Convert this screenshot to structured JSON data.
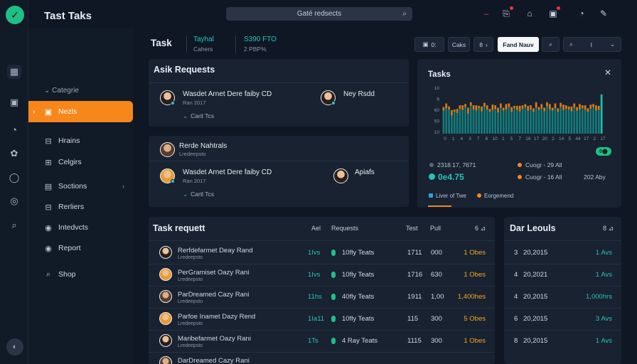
{
  "app": {
    "title": "Tast Taks",
    "logo_glyph": "✓"
  },
  "rail_icons": [
    "building-icon",
    "box-icon",
    "gauge-icon",
    "gear-icon",
    "circle-icon",
    "target-icon",
    "search-doc-icon"
  ],
  "rail_bottom": "◐",
  "sidebar": {
    "section_label": "Categrie",
    "items": [
      {
        "label": "Nezls",
        "icon": "▣",
        "active": true
      },
      {
        "label": "Hrains",
        "icon": "⊟"
      },
      {
        "label": "Celgirs",
        "icon": "⊞"
      },
      {
        "label": "Soctions",
        "icon": "▤",
        "chevron": "›"
      },
      {
        "label": "Rerliers",
        "icon": "⊟"
      },
      {
        "label": "Intedvcts",
        "icon": "◉"
      },
      {
        "label": "Report",
        "icon": "◉"
      },
      {
        "label": "Shop",
        "icon": "⌕"
      }
    ]
  },
  "topbar": {
    "search_placeholder": "Gaté redsects",
    "search_icon": "⌕",
    "icons": [
      {
        "name": "minus-icon",
        "glyph": "–",
        "color": "#e5393c"
      },
      {
        "name": "clipboard-icon",
        "glyph": "⎘",
        "dot": true
      },
      {
        "name": "home-icon",
        "glyph": "⌂"
      },
      {
        "name": "calendar-icon",
        "glyph": "▣",
        "dot": true
      },
      {
        "name": "palette-icon",
        "glyph": "◔"
      },
      {
        "name": "tools-icon",
        "glyph": "✎"
      }
    ]
  },
  "header": {
    "title": "Task",
    "meta": [
      {
        "value": "Tayhal",
        "label": "Cahers"
      },
      {
        "value": "Ѕ390 FTO",
        "label": "2 PBP%"
      }
    ],
    "buttons": [
      {
        "label": "0:",
        "icon": "▣"
      },
      {
        "label": "Caks"
      },
      {
        "label": "›",
        "icon": "8"
      },
      {
        "label": "Fand Nauv",
        "primary": true
      },
      {
        "label": "⌕"
      },
      {
        "label": "I",
        "icon": "⌕",
        "chevron": "⌄"
      }
    ]
  },
  "requests": {
    "title": "Asik Requests",
    "rows": [
      {
        "left": {
          "name": "Wasdet Arnet Dere faiby CD",
          "sub": "Ran 2017",
          "tag": "Carit Tcs"
        },
        "right": {
          "name": "Ney Rsdd"
        }
      },
      {
        "single": {
          "name": "Rerde Nahtrals",
          "sub": "Lredeepsto"
        }
      },
      {
        "left": {
          "name": "Wasdet Arnet Dere faiby CD",
          "sub": "Ran 2017",
          "tag": "Cartl Tcs"
        },
        "right": {
          "name": "Apiafs"
        }
      }
    ]
  },
  "tasks_panel": {
    "title": "Tasks",
    "close": "✕",
    "badge": "0⬤",
    "y_ticks": [
      "10",
      "8",
      "60",
      "50",
      "10"
    ],
    "x_ticks": [
      "0",
      "1",
      "4",
      "3",
      "7",
      "6",
      "10",
      "1",
      "5",
      "7",
      "16",
      "17",
      "20",
      "2",
      "14",
      "5",
      "44",
      "17",
      "2",
      "17"
    ],
    "stats": [
      {
        "text": "2318.17, 7671",
        "dot": "#5a6676"
      },
      {
        "text": "Cuogr - 29 All",
        "dot": "#f7861b"
      },
      {
        "text": "0e4.75",
        "dot": "#27c3ba",
        "big": true
      },
      {
        "text": "Cuogr - 16 All",
        "dot": "#f7861b"
      },
      {
        "text": "202 Aby"
      }
    ],
    "legend": [
      {
        "label": "Liver of Twe",
        "color": "#29a3e0"
      },
      {
        "label": "Eorgemend",
        "color": "#f7861b"
      }
    ]
  },
  "chart_data": {
    "type": "bar",
    "stacked": true,
    "x": [
      "0",
      "1",
      "4",
      "3",
      "7",
      "6",
      "10",
      "1",
      "5",
      "7",
      "16",
      "17",
      "20",
      "2",
      "14",
      "5",
      "44",
      "17",
      "2",
      "17"
    ],
    "series": [
      {
        "values": [
          38,
          42,
          40,
          30,
          36,
          34,
          41,
          39,
          44,
          33,
          46,
          40,
          38,
          42,
          37,
          45,
          40,
          36,
          39,
          41,
          35,
          43,
          38,
          40,
          44,
          36,
          42,
          39,
          37,
          41,
          44,
          38,
          40,
          36,
          43,
          39,
          41,
          37,
          45,
          40,
          38,
          42,
          36,
          44,
          39,
          41,
          40,
          37,
          43,
          38,
          40,
          42,
          39,
          36,
          41,
          44,
          38,
          40,
          65
        ]
      },
      {
        "values": [
          6,
          8,
          5,
          9,
          4,
          7,
          6,
          8,
          5,
          10,
          6,
          7,
          9,
          4,
          8,
          6,
          7,
          5,
          9,
          6,
          8,
          7,
          5,
          9,
          6,
          8,
          4,
          7,
          9,
          6,
          5,
          8,
          7,
          6,
          9,
          5,
          8,
          6,
          7,
          9,
          5,
          8,
          6,
          7,
          9,
          6,
          5,
          8,
          7,
          6,
          9,
          5,
          8,
          6,
          7,
          5,
          9,
          6,
          0
        ]
      }
    ],
    "ylim": [
      0,
      80
    ],
    "grid": false,
    "colors": {
      "primary": "#157a7a",
      "secondary": "#d57a1a"
    }
  },
  "task_table": {
    "title": "Task requett",
    "columns": [
      "Ael",
      "Requests",
      "Test",
      "Pull",
      "6 ⊿"
    ],
    "rows": [
      {
        "name": "Rerfdefarmet Deay Rand",
        "sub": "Lredeepsto",
        "a": "1Ivs",
        "req": "10fly Teats",
        "t": "1711",
        "p": "000",
        "v": "1 Obes"
      },
      {
        "name": "PerGramiset Oazy Rani",
        "sub": "Lredeepsto",
        "a": "1Ivs",
        "req": "10fly Teats",
        "t": "1716",
        "p": "630",
        "v": "1 Obes"
      },
      {
        "name": "ParDreamed Cazy Rani",
        "sub": "Lredeepsto",
        "a": "11hs",
        "req": "40fly Teats",
        "t": "1911",
        "p": "1,00",
        "v": "1,400hes"
      },
      {
        "name": "Parfoe Inamet Dazy Rend",
        "sub": "Lredeepsto",
        "a": "1Ia11",
        "req": "10fly Teats",
        "t": "115",
        "p": "300",
        "v": "5 Obes"
      },
      {
        "name": "Maribefarmet Oazy Rani",
        "sub": "Lredeepsto",
        "a": "1Ts",
        "req": "4 Ray Teats",
        "t": "1115",
        "p": "300",
        "v": "1 Obes"
      },
      {
        "name": "DarDreamed Cazy Rani",
        "sub": "",
        "a": "",
        "req": "",
        "t": "",
        "p": "",
        "v": ""
      }
    ]
  },
  "dar_table": {
    "title": "Dar Leouls",
    "head_right": "8 ⊿",
    "rows": [
      {
        "n": "3",
        "date": "20,2015",
        "v": "1 Avs"
      },
      {
        "n": "4",
        "date": "20,2021",
        "v": "1 Avs"
      },
      {
        "n": "4",
        "date": "20,2015",
        "v": "1,000hrs"
      },
      {
        "n": "6",
        "date": "20,2015",
        "v": "3 Avs"
      },
      {
        "n": "8",
        "date": "20,2015",
        "v": "1 Avs"
      }
    ]
  }
}
